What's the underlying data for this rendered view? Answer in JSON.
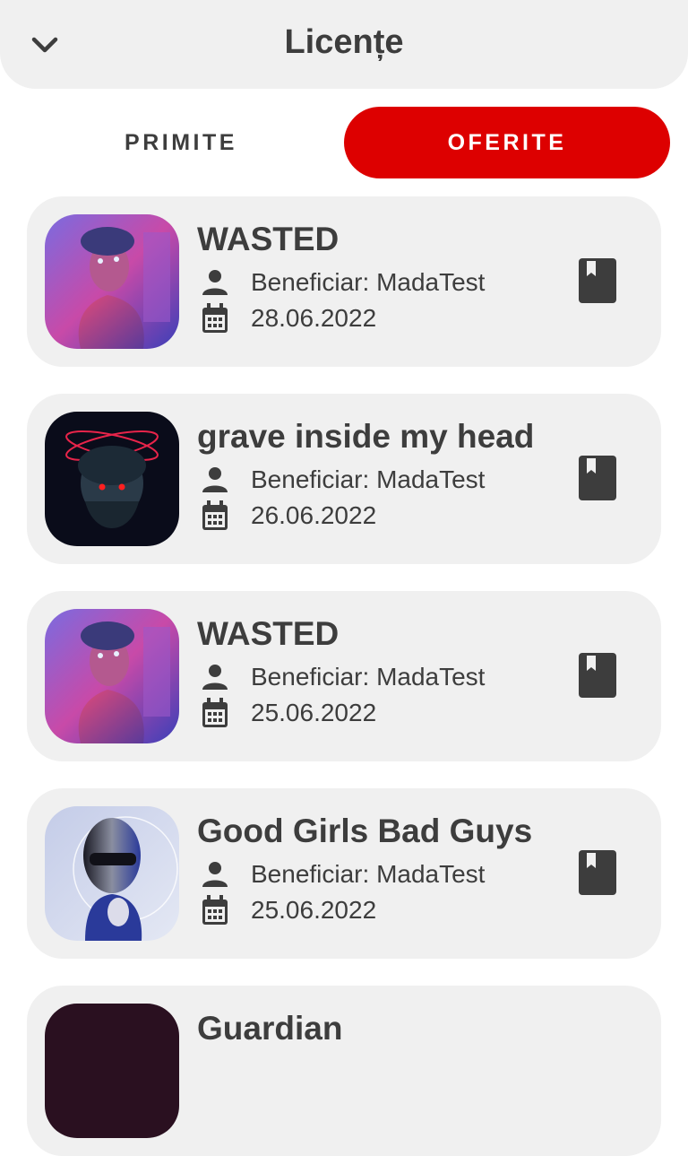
{
  "header": {
    "title": "Licențe",
    "back_icon": "chevron-down-icon"
  },
  "tabs": [
    {
      "label": "PRIMITE",
      "active": false
    },
    {
      "label": "OFERITE",
      "active": true
    }
  ],
  "colors": {
    "accent": "#dd0000",
    "card_bg": "#f0f0f0",
    "text": "#3d3d3d"
  },
  "licenses": [
    {
      "title": "WASTED",
      "beneficiary": "Beneficiar: MadaTest",
      "date": "28.06.2022",
      "artwork": "statue-pink-neon"
    },
    {
      "title": "grave inside my head",
      "beneficiary": "Beneficiar: MadaTest",
      "date": "26.06.2022",
      "artwork": "statue-red-eyes-halo"
    },
    {
      "title": "WASTED",
      "beneficiary": "Beneficiar: MadaTest",
      "date": "25.06.2022",
      "artwork": "statue-pink-neon"
    },
    {
      "title": "Good Girls Bad Guys",
      "beneficiary": "Beneficiar: MadaTest",
      "date": "25.06.2022",
      "artwork": "chrome-head-blue"
    },
    {
      "title": "Guardian",
      "beneficiary": "",
      "date": "",
      "artwork": "dark-purple"
    }
  ]
}
